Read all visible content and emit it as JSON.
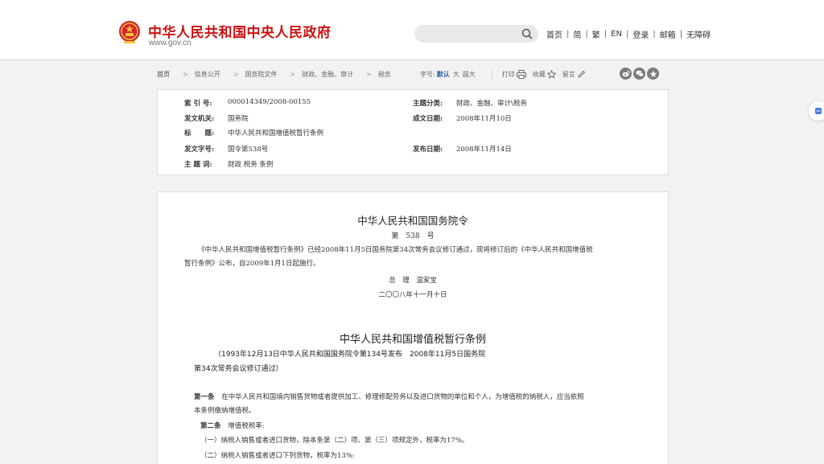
{
  "header": {
    "site_title": "中华人民共和国中央人民政府",
    "site_url": "www.gov.cn",
    "search_placeholder": "",
    "nav": [
      "首页",
      "简",
      "繁",
      "EN",
      "登录",
      "邮箱",
      "无障碍"
    ],
    "nav_separator": "|"
  },
  "breadcrumb": {
    "items": [
      "首页",
      "信息公开",
      "国务院文件",
      "财政、金融、审计",
      "税务"
    ],
    "arrow": ">"
  },
  "tools": {
    "font_size_label": "字号:",
    "font_default": "默认",
    "font_large": "大",
    "font_xlarge": "超大",
    "print": "打印",
    "favorite": "收藏",
    "comment": "留言"
  },
  "info": {
    "index_no_label": "索 引 号:",
    "index_no": "000014349/2008-00155",
    "category_label": "主题分类:",
    "category": "财政、金融、审计\\税务",
    "issuer_label": "发文机关:",
    "issuer": "国务院",
    "written_date_label": "成文日期:",
    "written_date": "2008年11月10日",
    "title_label": "标　　题:",
    "title": "中华人民共和国增值税暂行条例",
    "doc_no_label": "发文字号:",
    "doc_no": "国令第538号",
    "publish_date_label": "发布日期:",
    "publish_date": "2008年11月14日",
    "keywords_label": "主 题 词:",
    "keywords": "财政 税务 条例"
  },
  "article": {
    "decree_title": "中华人民共和国国务院令",
    "decree_num": "第　538　号",
    "decree_para_1": "《中华人民共和国增值税暂行条例》已经2008年11月5日国务院第34次常务会议修订通过，现将修订后的《中华人民共和国增值税",
    "decree_para_2": "暂行条例》公布，自2009年1月1日起施行。",
    "signer": "总　理　温家宝",
    "sign_date": "二〇〇八年十一月十日",
    "reg_title": "中华人民共和国增值税暂行条例",
    "reg_note_1": "（1993年12月13日中华人民共和国国务院令第134号发布　2008年11月5日国务院",
    "reg_note_2": "第34次常务会议修订通过）",
    "art1_label": "第一条",
    "art1_text_1": "在中华人民共和国境内销售货物或者提供加工、修理修配劳务以及进口货物的单位和个人，为增值税的纳税人，应当依照",
    "art1_text_2": "本条例缴纳增值税。",
    "art2_label": "第二条",
    "art2_text": "增值税税率:",
    "art2_item1": "（一）纳税人销售或者进口货物，除本条第（二）项、第（三）项规定外，税率为17%。",
    "art2_item2": "（二）纳税人销售或者进口下列货物，税率为13%:"
  },
  "colors": {
    "title_red": "#cc1111",
    "accent_blue": "#2a5ea8"
  }
}
